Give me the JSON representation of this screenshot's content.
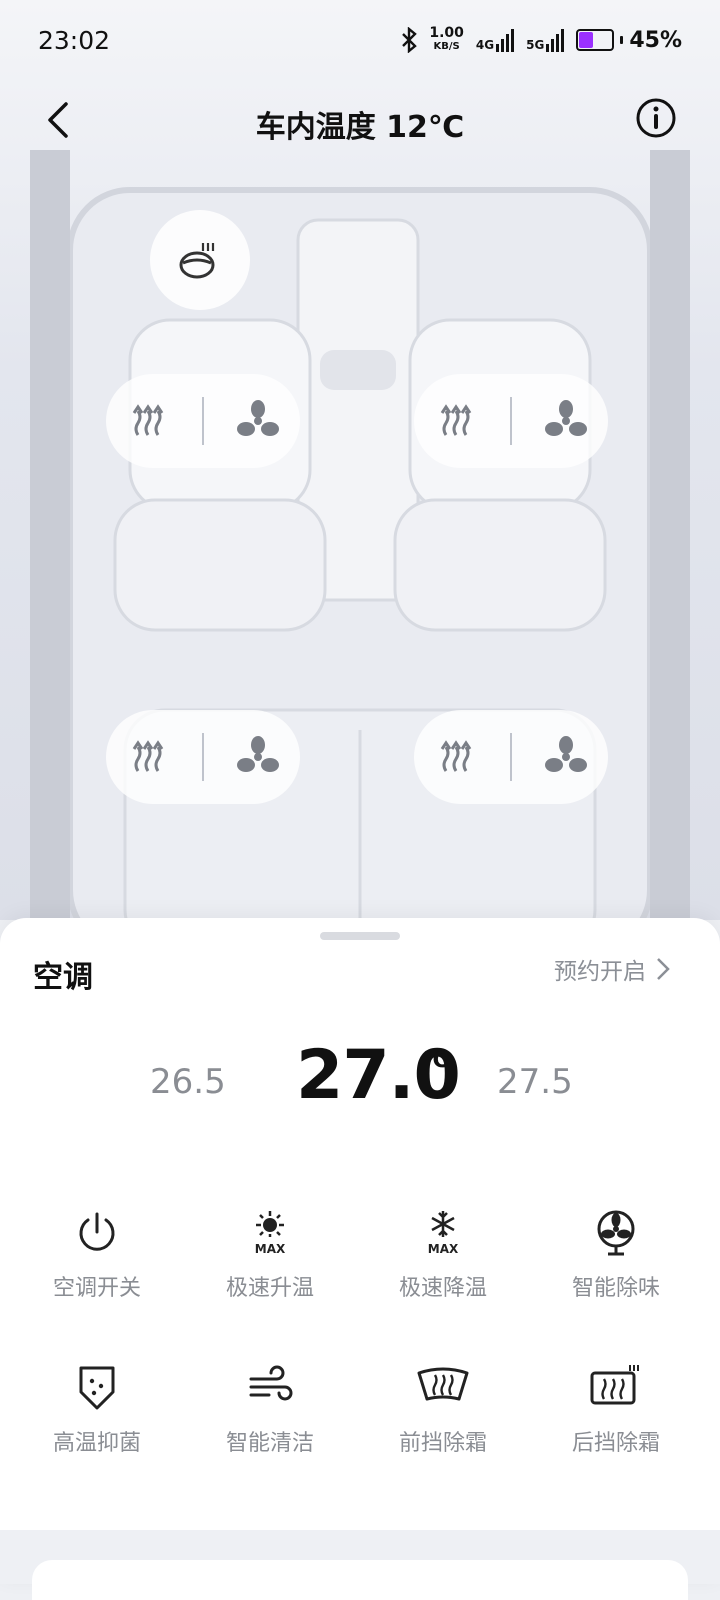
{
  "status": {
    "time": "23:02",
    "speed_value": "1.00",
    "speed_unit": "KB/S",
    "net1": "4G",
    "net2": "5G",
    "battery": "45%",
    "battery_level": 0.45,
    "battery_color": "#9b30ff"
  },
  "header": {
    "title": "车内温度 12℃"
  },
  "icons": {
    "back": "chevron-left-icon",
    "info": "info-icon",
    "steering": "steering-heat-icon",
    "seat_heat": "seat-heat-icon",
    "seat_fan": "fan-icon"
  },
  "panel": {
    "title": "空调",
    "schedule_label": "预约开启",
    "temp_prev": "26.5",
    "temp_current": "27.0",
    "temp_unit": "℃",
    "temp_next": "27.5"
  },
  "functions": [
    {
      "label": "空调开关",
      "icon": "power-icon"
    },
    {
      "label": "极速升温",
      "icon": "sun-max-icon"
    },
    {
      "label": "极速降温",
      "icon": "snow-max-icon"
    },
    {
      "label": "智能除味",
      "icon": "fan-icon"
    },
    {
      "label": "高温抑菌",
      "icon": "shield-icon"
    },
    {
      "label": "智能清洁",
      "icon": "wind-icon"
    },
    {
      "label": "前挡除霜",
      "icon": "front-defrost-icon"
    },
    {
      "label": "后挡除霜",
      "icon": "rear-defrost-icon"
    }
  ],
  "icon_text": {
    "max": "MAX"
  }
}
